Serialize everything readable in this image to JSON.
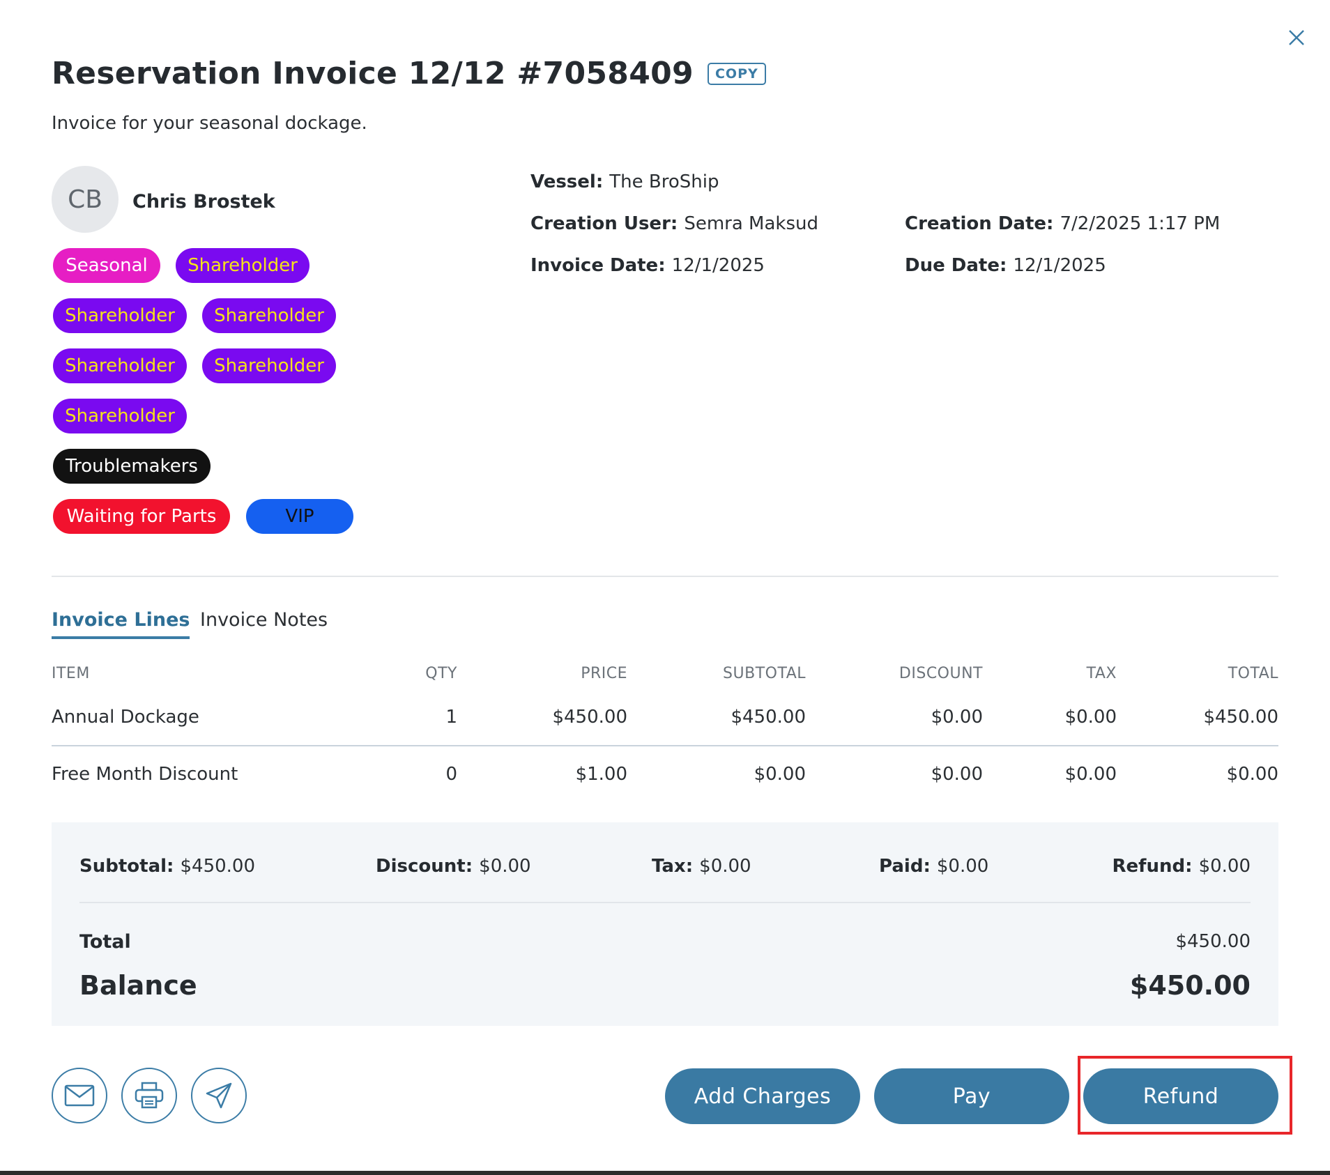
{
  "modal": {
    "title": "Reservation Invoice 12/12 #7058409",
    "copy_label": "COPY",
    "subtitle": "Invoice for your seasonal dockage."
  },
  "customer": {
    "initials": "CB",
    "name": "Chris Brostek"
  },
  "tags": [
    {
      "label": "Seasonal",
      "color": "#e61ec4"
    },
    {
      "label": "Shareholder",
      "color": "#7a0af0"
    },
    {
      "label": "Shareholder",
      "color": "#7a0af0"
    },
    {
      "label": "Shareholder",
      "color": "#7a0af0"
    },
    {
      "label": "Shareholder",
      "color": "#7a0af0"
    },
    {
      "label": "Shareholder",
      "color": "#7a0af0"
    },
    {
      "label": "Shareholder",
      "color": "#7a0af0"
    },
    {
      "label": "Troublemakers",
      "color": "#121212"
    },
    {
      "label": "Waiting for Parts",
      "color": "#f2122e"
    },
    {
      "label": "VIP",
      "color": "#1560f0"
    }
  ],
  "details": {
    "vessel_label": "Vessel",
    "vessel": "The BroShip",
    "creation_user_label": "Creation User",
    "creation_user": "Semra Maksud",
    "creation_date_label": "Creation Date",
    "creation_date": "7/2/2025 1:17 PM",
    "invoice_date_label": "Invoice Date",
    "invoice_date": "12/1/2025",
    "due_date_label": "Due Date",
    "due_date": "12/1/2025"
  },
  "tabs": [
    {
      "label": "Invoice Lines",
      "active": true
    },
    {
      "label": "Invoice Notes",
      "active": false
    }
  ],
  "table": {
    "headers": [
      "ITEM",
      "QTY",
      "PRICE",
      "SUBTOTAL",
      "DISCOUNT",
      "TAX",
      "TOTAL"
    ],
    "rows": [
      [
        "Annual Dockage",
        "1",
        "$450.00",
        "$450.00",
        "$0.00",
        "$0.00",
        "$450.00"
      ],
      [
        "Free Month Discount",
        "0",
        "$1.00",
        "$0.00",
        "$0.00",
        "$0.00",
        "$0.00"
      ]
    ]
  },
  "summary": {
    "subtotal_label": "Subtotal",
    "subtotal": "$450.00",
    "discount_label": "Discount",
    "discount": "$0.00",
    "tax_label": "Tax",
    "tax": "$0.00",
    "paid_label": "Paid",
    "paid": "$0.00",
    "refund_label": "Refund",
    "refund": "$0.00",
    "total_label": "Total",
    "total": "$450.00",
    "balance_label": "Balance",
    "balance": "$450.00"
  },
  "footer": {
    "icons": [
      "mail-icon",
      "print-icon",
      "send-icon"
    ],
    "add_charges_label": "Add Charges",
    "pay_label": "Pay",
    "refund_label": "Refund"
  },
  "colors": {
    "accent": "#3a7aa3",
    "highlight": "#e8262a"
  }
}
